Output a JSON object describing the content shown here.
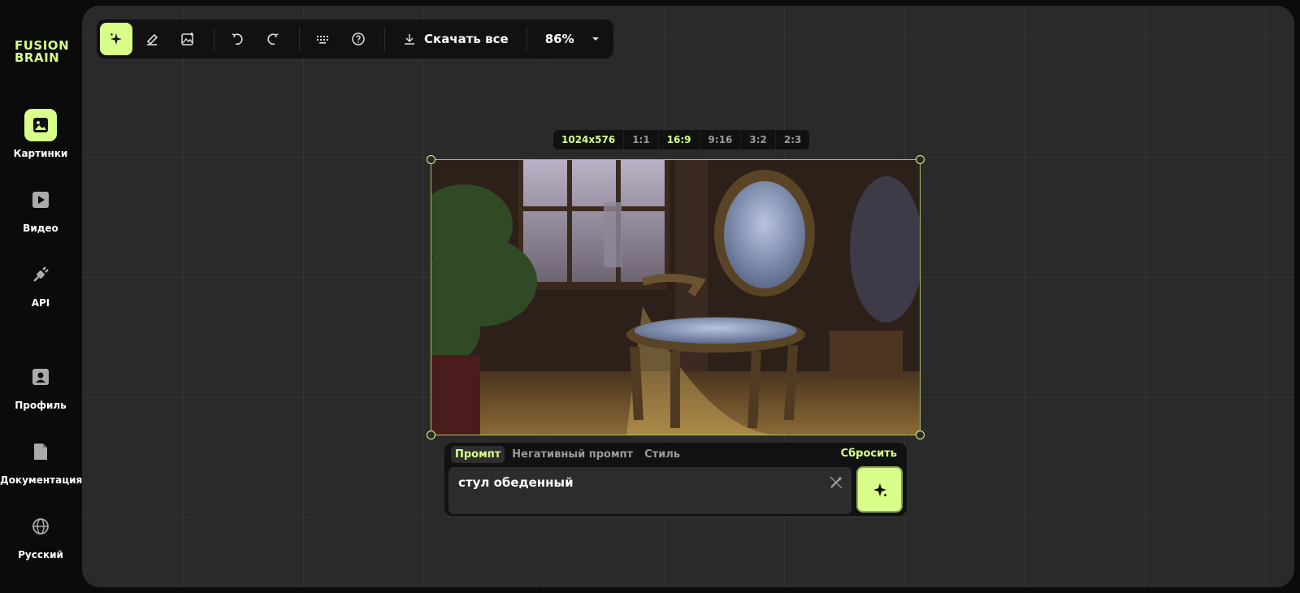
{
  "logo": {
    "line1": "FUSION",
    "line2": "BRAIN"
  },
  "sidebar": {
    "items": [
      {
        "label": "Картинки",
        "icon": "image-icon",
        "active": true
      },
      {
        "label": "Видео",
        "icon": "video-play-icon",
        "active": false
      },
      {
        "label": "API",
        "icon": "plug-icon",
        "active": false
      },
      {
        "label": "Профиль",
        "icon": "profile-icon",
        "active": false
      },
      {
        "label": "Документация",
        "icon": "document-icon",
        "active": false
      },
      {
        "label": "Русский",
        "icon": "globe-icon",
        "active": false
      }
    ]
  },
  "toolbar": {
    "tools": [
      "sparkle-icon",
      "eraser-icon",
      "image-add-icon",
      "undo-icon",
      "redo-icon",
      "keyboard-icon",
      "help-icon"
    ],
    "download_label": "Скачать все",
    "zoom": "86%"
  },
  "ratio_bar": {
    "size": "1024x576",
    "ratios": [
      "1:1",
      "16:9",
      "9:16",
      "3:2",
      "2:3"
    ],
    "selected": "16:9"
  },
  "prompt": {
    "tabs": [
      "Промпт",
      "Негативный промпт",
      "Стиль"
    ],
    "active_tab": "Промпт",
    "reset_label": "Сбросить",
    "value": "стул обеденный"
  },
  "colors": {
    "accent": "#d8ff8a",
    "canvas": "#2a2a2a",
    "panel": "#111111"
  }
}
